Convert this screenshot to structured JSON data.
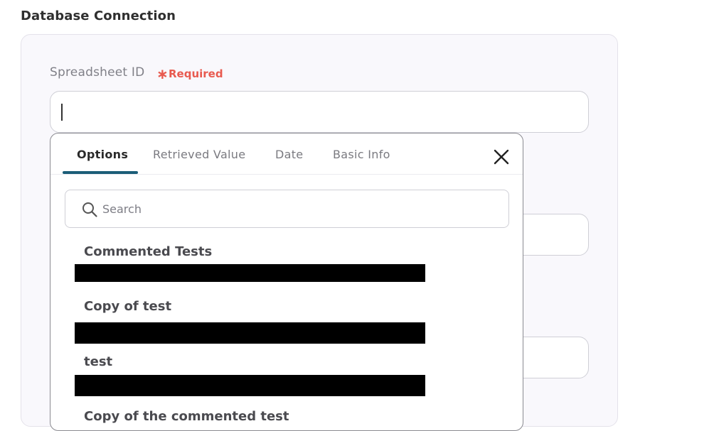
{
  "section": {
    "title": "Database Connection"
  },
  "field": {
    "label": "Spreadsheet ID",
    "required_star": "∗",
    "required_text": "Required",
    "value": ""
  },
  "popup": {
    "tabs": [
      {
        "label": "Options",
        "active": true
      },
      {
        "label": "Retrieved Value",
        "active": false
      },
      {
        "label": "Date",
        "active": false
      },
      {
        "label": "Basic Info",
        "active": false
      }
    ],
    "search": {
      "placeholder": "Search",
      "value": ""
    },
    "options": [
      {
        "title": "Commented Tests"
      },
      {
        "title": "Copy of test"
      },
      {
        "title": "test"
      },
      {
        "title": "Copy of the commented test"
      }
    ]
  },
  "colors": {
    "accent": "#1b5d78",
    "required": "#e85a4f",
    "panel_bg": "#f9f8fc"
  },
  "icons": {
    "close": "close-icon",
    "search": "search-icon"
  }
}
